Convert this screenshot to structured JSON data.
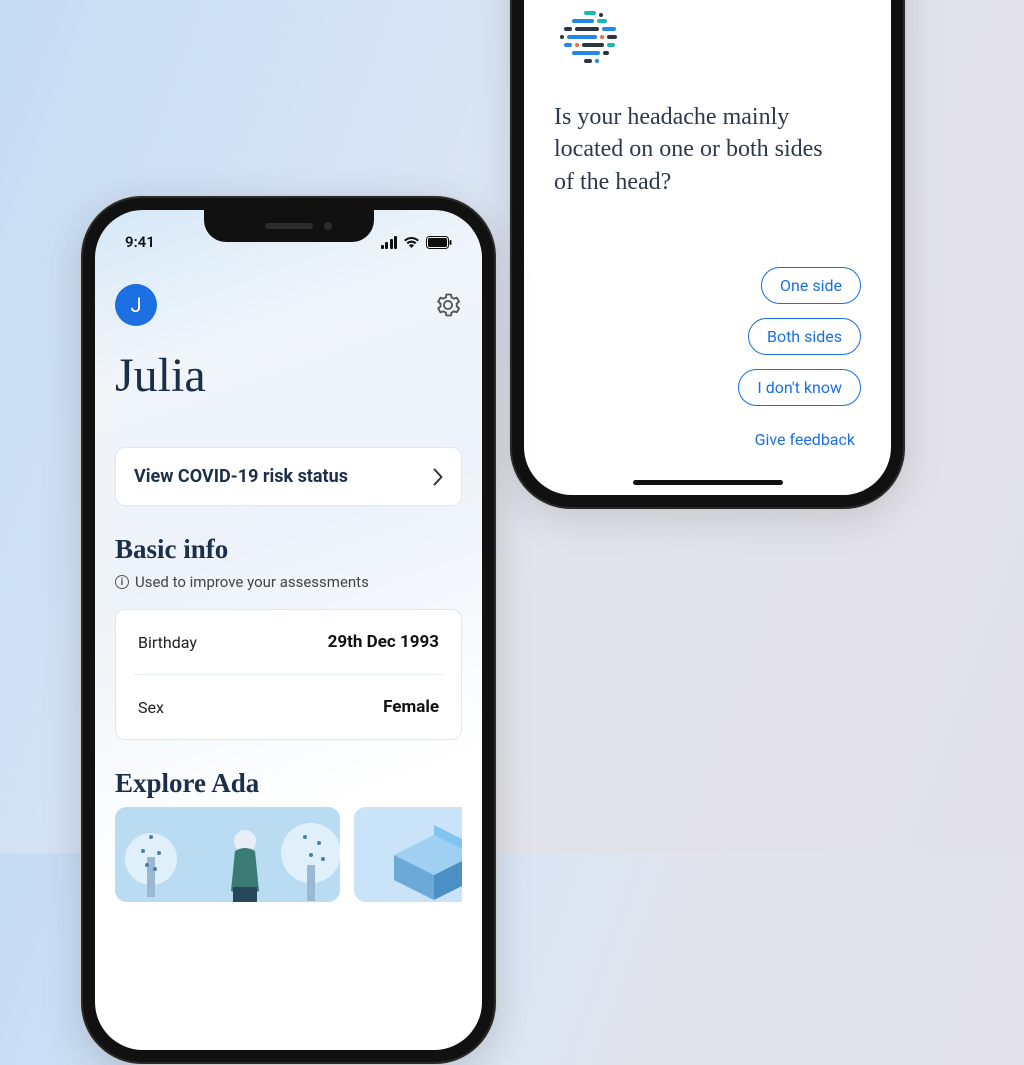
{
  "phone1": {
    "status_time": "9:41",
    "profile_initial": "J",
    "title": "Julia",
    "covid_card_label": "View COVID-19 risk status",
    "basic_info_title": "Basic info",
    "basic_info_caption": "Used to improve your assessments",
    "rows": [
      {
        "key": "Birthday",
        "value": "29th Dec 1993"
      },
      {
        "key": "Sex",
        "value": "Female"
      }
    ],
    "explore_title": "Explore Ada"
  },
  "phone2": {
    "question": "Is your headache mainly located on one or both sides of the head?",
    "options": [
      "One side",
      "Both sides",
      "I don't know"
    ],
    "feedback_label": "Give feedback"
  },
  "colors": {
    "primary": "#1b6fe0",
    "heading": "#1c2f4a"
  }
}
